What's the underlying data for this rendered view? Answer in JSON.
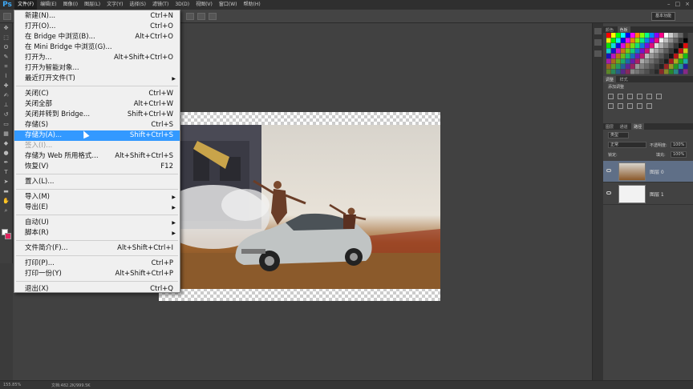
{
  "app": {
    "logo": "Ps"
  },
  "menubar": {
    "items": [
      "文件(F)",
      "编辑(E)",
      "图像(I)",
      "图层(L)",
      "文字(Y)",
      "选择(S)",
      "滤镜(T)",
      "3D(D)",
      "视图(V)",
      "窗口(W)",
      "帮助(H)"
    ],
    "window_controls": [
      "–",
      "□",
      "×"
    ]
  },
  "options": {
    "workspace": "基本功能"
  },
  "file_menu": {
    "items": [
      {
        "label": "新建(N)...",
        "shortcut": "Ctrl+N"
      },
      {
        "label": "打开(O)...",
        "shortcut": "Ctrl+O"
      },
      {
        "label": "在 Bridge 中浏览(B)...",
        "shortcut": "Alt+Ctrl+O"
      },
      {
        "label": "在 Mini Bridge 中浏览(G)...",
        "shortcut": ""
      },
      {
        "label": "打开为...",
        "shortcut": "Alt+Shift+Ctrl+O"
      },
      {
        "label": "打开为智能对象...",
        "shortcut": ""
      },
      {
        "label": "最近打开文件(T)",
        "shortcut": "",
        "submenu": true
      },
      {
        "label": "关闭(C)",
        "shortcut": "Ctrl+W"
      },
      {
        "label": "关闭全部",
        "shortcut": "Alt+Ctrl+W"
      },
      {
        "label": "关闭并转到 Bridge...",
        "shortcut": "Shift+Ctrl+W"
      },
      {
        "label": "存储(S)",
        "shortcut": "Ctrl+S"
      },
      {
        "label": "存储为(A)...",
        "shortcut": "Shift+Ctrl+S",
        "highlight": true
      },
      {
        "label": "签入(I)...",
        "shortcut": "",
        "disabled": true
      },
      {
        "label": "存储为 Web 所用格式...",
        "shortcut": "Alt+Shift+Ctrl+S"
      },
      {
        "label": "恢复(V)",
        "shortcut": "F12"
      },
      {
        "label": "置入(L)...",
        "shortcut": ""
      },
      {
        "label": "导入(M)",
        "shortcut": "",
        "submenu": true
      },
      {
        "label": "导出(E)",
        "shortcut": "",
        "submenu": true
      },
      {
        "label": "自动(U)",
        "shortcut": "",
        "submenu": true
      },
      {
        "label": "脚本(R)",
        "shortcut": "",
        "submenu": true
      },
      {
        "label": "文件简介(F)...",
        "shortcut": "Alt+Shift+Ctrl+I"
      },
      {
        "label": "打印(P)...",
        "shortcut": "Ctrl+P"
      },
      {
        "label": "打印一份(Y)",
        "shortcut": "Alt+Shift+Ctrl+P"
      },
      {
        "label": "退出(X)",
        "shortcut": "Ctrl+Q"
      }
    ]
  },
  "panels": {
    "color_tabs": [
      "颜色",
      "色板"
    ],
    "adjust_tabs": [
      "调整",
      "样式"
    ],
    "adjust_title": "添加调整",
    "layers_tabs": [
      "图层",
      "通道",
      "路径"
    ],
    "kind_label": "类型",
    "blend_mode": "正常",
    "opacity_label": "不透明度:",
    "opacity_value": "100%",
    "lock_label": "锁定:",
    "fill_label": "填充:",
    "fill_value": "100%",
    "layers": [
      {
        "name": "图层 0",
        "selected": true
      },
      {
        "name": "图层 1",
        "selected": false
      }
    ]
  },
  "status": {
    "zoom": "155.85%",
    "doc": "文档:482.2K/999.5K"
  },
  "colors": {
    "highlight": "#3399ff",
    "foreground": "#ffffff",
    "background": "#e0245e"
  }
}
